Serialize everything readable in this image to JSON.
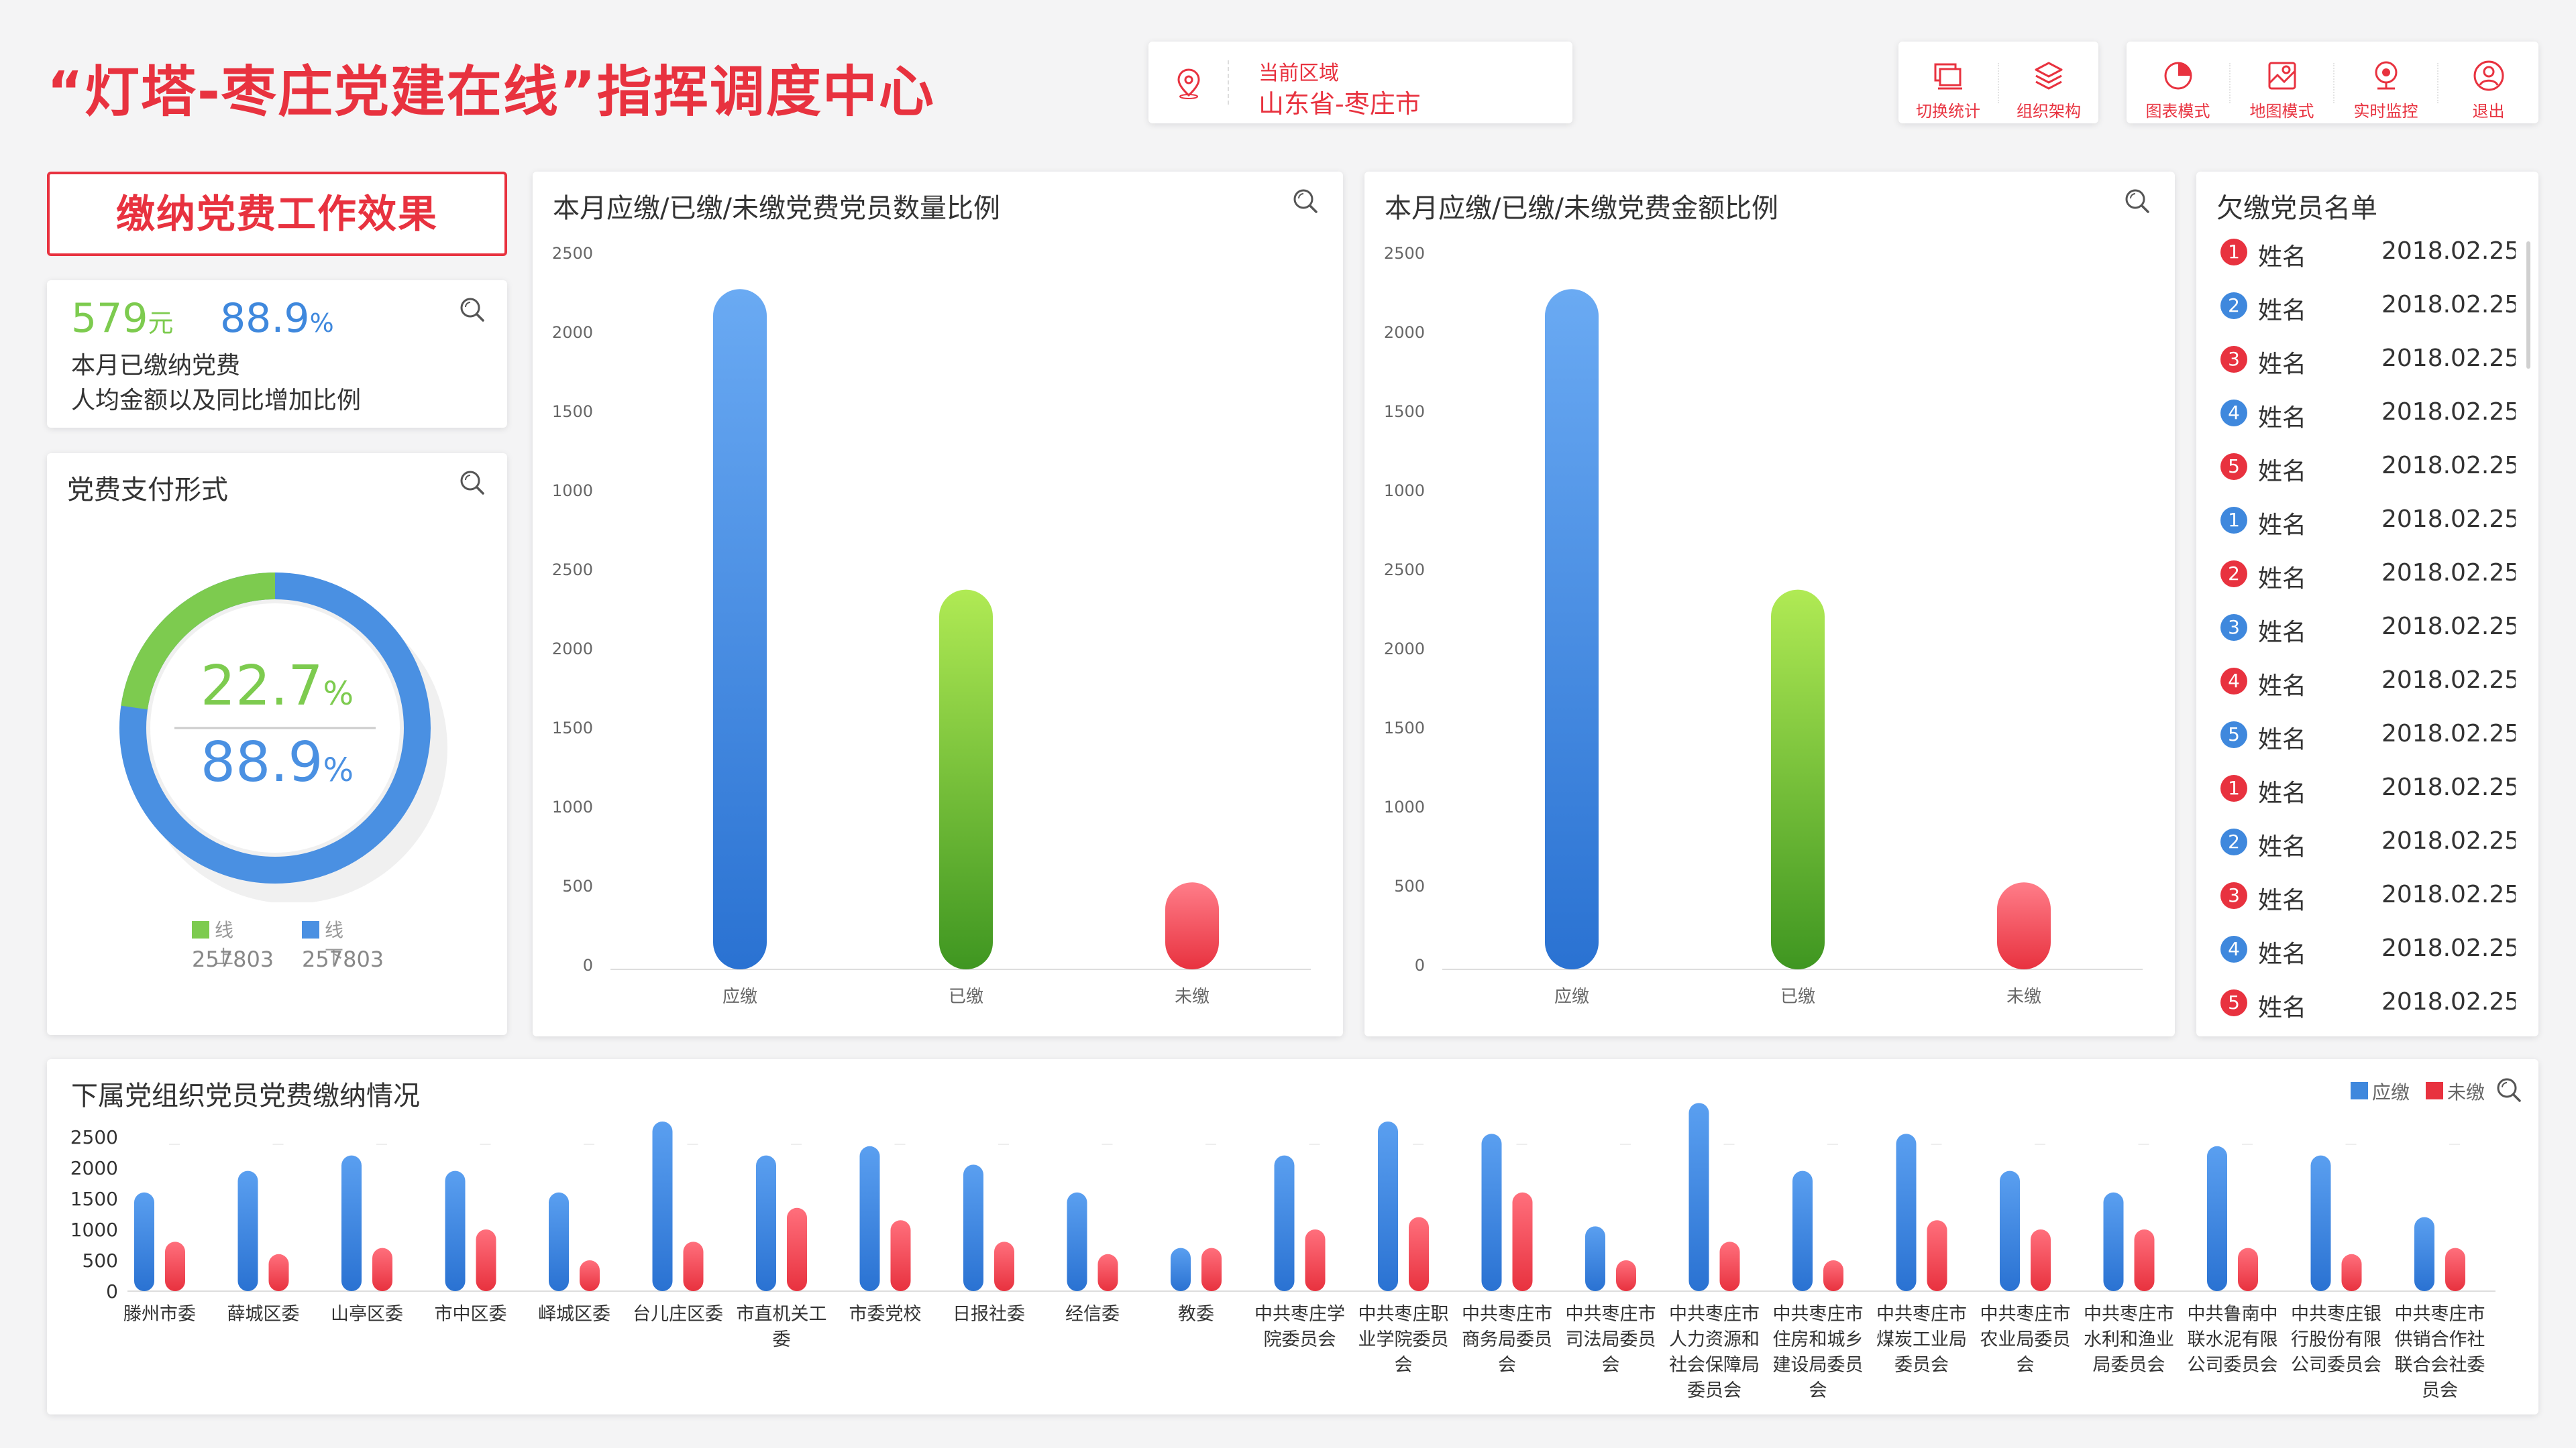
{
  "header": {
    "title": "“灯塔-枣庄党建在线”指挥调度中心",
    "region_label": "当前区域",
    "region_value": "山东省-枣庄市",
    "toolbar_left": [
      {
        "label": "切换统计",
        "icon": "switch-stats-icon"
      },
      {
        "label": "组织架构",
        "icon": "org-structure-icon"
      }
    ],
    "toolbar_right": [
      {
        "label": "图表模式",
        "icon": "chart-mode-icon"
      },
      {
        "label": "地图模式",
        "icon": "map-mode-icon"
      },
      {
        "label": "实时监控",
        "icon": "monitor-icon"
      },
      {
        "label": "退出",
        "icon": "logout-icon"
      }
    ]
  },
  "effect": {
    "title": "缴纳党费工作效果",
    "amount": "579",
    "amount_unit": "元",
    "ratio": "88.9",
    "ratio_unit": "%",
    "desc_line1": "本月已缴纳党费",
    "desc_line2": "人均金额以及同比增加比例"
  },
  "payment": {
    "title": "党费支付形式",
    "online_pct": "22.7",
    "offline_pct": "88.9",
    "pct_unit": "%",
    "legend": [
      {
        "name": "线上",
        "value": "257803",
        "color": "#7dcb4f"
      },
      {
        "name": "线下",
        "value": "257803",
        "color": "#4a90e2"
      }
    ]
  },
  "chart_count": {
    "title": "本月应缴/已缴/未缴党费党员数量比例",
    "yticks": [
      "2500",
      "2000",
      "1500",
      "1000",
      "2500",
      "2000",
      "1500",
      "1000",
      "500",
      "0"
    ],
    "categories": [
      "应缴",
      "已缴",
      "未缴"
    ]
  },
  "chart_amount": {
    "title": "本月应缴/已缴/未缴党费金额比例",
    "yticks": [
      "2500",
      "2000",
      "1500",
      "1000",
      "2500",
      "2000",
      "1500",
      "1000",
      "500",
      "0"
    ],
    "categories": [
      "应缴",
      "已缴",
      "未缴"
    ]
  },
  "arrears": {
    "title": "欠缴党员名单",
    "rows": [
      {
        "num": "1",
        "name": "姓名",
        "date": "2018.02.25",
        "color": "#e8323f"
      },
      {
        "num": "2",
        "name": "姓名",
        "date": "2018.02.25",
        "color": "#3f88dd"
      },
      {
        "num": "3",
        "name": "姓名",
        "date": "2018.02.25",
        "color": "#e8323f"
      },
      {
        "num": "4",
        "name": "姓名",
        "date": "2018.02.25",
        "color": "#3f88dd"
      },
      {
        "num": "5",
        "name": "姓名",
        "date": "2018.02.25",
        "color": "#e8323f"
      },
      {
        "num": "1",
        "name": "姓名",
        "date": "2018.02.25",
        "color": "#3f88dd"
      },
      {
        "num": "2",
        "name": "姓名",
        "date": "2018.02.25",
        "color": "#e8323f"
      },
      {
        "num": "3",
        "name": "姓名",
        "date": "2018.02.25",
        "color": "#3f88dd"
      },
      {
        "num": "4",
        "name": "姓名",
        "date": "2018.02.25",
        "color": "#e8323f"
      },
      {
        "num": "5",
        "name": "姓名",
        "date": "2018.02.25",
        "color": "#3f88dd"
      },
      {
        "num": "1",
        "name": "姓名",
        "date": "2018.02.25",
        "color": "#e8323f"
      },
      {
        "num": "2",
        "name": "姓名",
        "date": "2018.02.25",
        "color": "#3f88dd"
      },
      {
        "num": "3",
        "name": "姓名",
        "date": "2018.02.25",
        "color": "#e8323f"
      },
      {
        "num": "4",
        "name": "姓名",
        "date": "2018.02.25",
        "color": "#3f88dd"
      },
      {
        "num": "5",
        "name": "姓名",
        "date": "2018.02.25",
        "color": "#e8323f"
      }
    ]
  },
  "bottom": {
    "title": "下属党组织党员党费缴纳情况",
    "legend": [
      {
        "name": "应缴",
        "color": "#3f88dd"
      },
      {
        "name": "未缴",
        "color": "#e8323f"
      }
    ],
    "yticks": [
      "2500",
      "2000",
      "1500",
      "1000",
      "500",
      "0"
    ]
  },
  "chart_data": [
    {
      "type": "bar",
      "title": "本月应缴/已缴/未缴党费党员数量比例",
      "categories": [
        "应缴",
        "已缴",
        "未缴"
      ],
      "values": [
        4300,
        2400,
        550
      ],
      "colors": [
        "#3f88dd",
        "#6fbe3a",
        "#ef4b5a"
      ]
    },
    {
      "type": "bar",
      "title": "本月应缴/已缴/未缴党费金额比例",
      "categories": [
        "应缴",
        "已缴",
        "未缴"
      ],
      "values": [
        4300,
        2400,
        550
      ],
      "colors": [
        "#3f88dd",
        "#6fbe3a",
        "#ef4b5a"
      ]
    },
    {
      "type": "pie",
      "title": "党费支付形式",
      "series": [
        {
          "name": "线上",
          "value": 22.7
        },
        {
          "name": "线下",
          "value": 77.3
        }
      ]
    },
    {
      "type": "bar",
      "title": "下属党组织党员党费缴纳情况",
      "ylim": [
        0,
        2500
      ],
      "categories": [
        "滕州市委",
        "薛城区委",
        "山亭区委",
        "市中区委",
        "峄城区委",
        "台儿庄区委",
        "市直机关工委",
        "市委党校",
        "日报社委",
        "经信委",
        "教委",
        "中共枣庄学院委员会",
        "中共枣庄职业学院委员会",
        "中共枣庄市商务局委员会",
        "中共枣庄市司法局委员会",
        "中共枣庄市人力资源和社会保障局委员会",
        "中共枣庄市住房和城乡建设局委员会",
        "中共枣庄市煤炭工业局委员会",
        "中共枣庄市农业局委员会",
        "中共枣庄市水利和渔业局委员会",
        "中共鲁南中联水泥有限公司委员会",
        "中共枣庄银行股份有限公司委员会",
        "中共枣庄市供销合作社联合会社委员会"
      ],
      "series": [
        {
          "name": "应缴",
          "values": [
            1600,
            1950,
            2200,
            1950,
            1600,
            2750,
            2200,
            2350,
            2050,
            1600,
            700,
            2200,
            2750,
            2550,
            1050,
            3050,
            1950,
            2550,
            1950,
            1600,
            2350,
            2200,
            1200
          ]
        },
        {
          "name": "未缴",
          "values": [
            800,
            600,
            700,
            1000,
            500,
            800,
            1350,
            1150,
            800,
            600,
            700,
            1000,
            1200,
            1600,
            500,
            800,
            500,
            1150,
            1000,
            1000,
            700,
            600,
            700
          ]
        }
      ]
    }
  ]
}
